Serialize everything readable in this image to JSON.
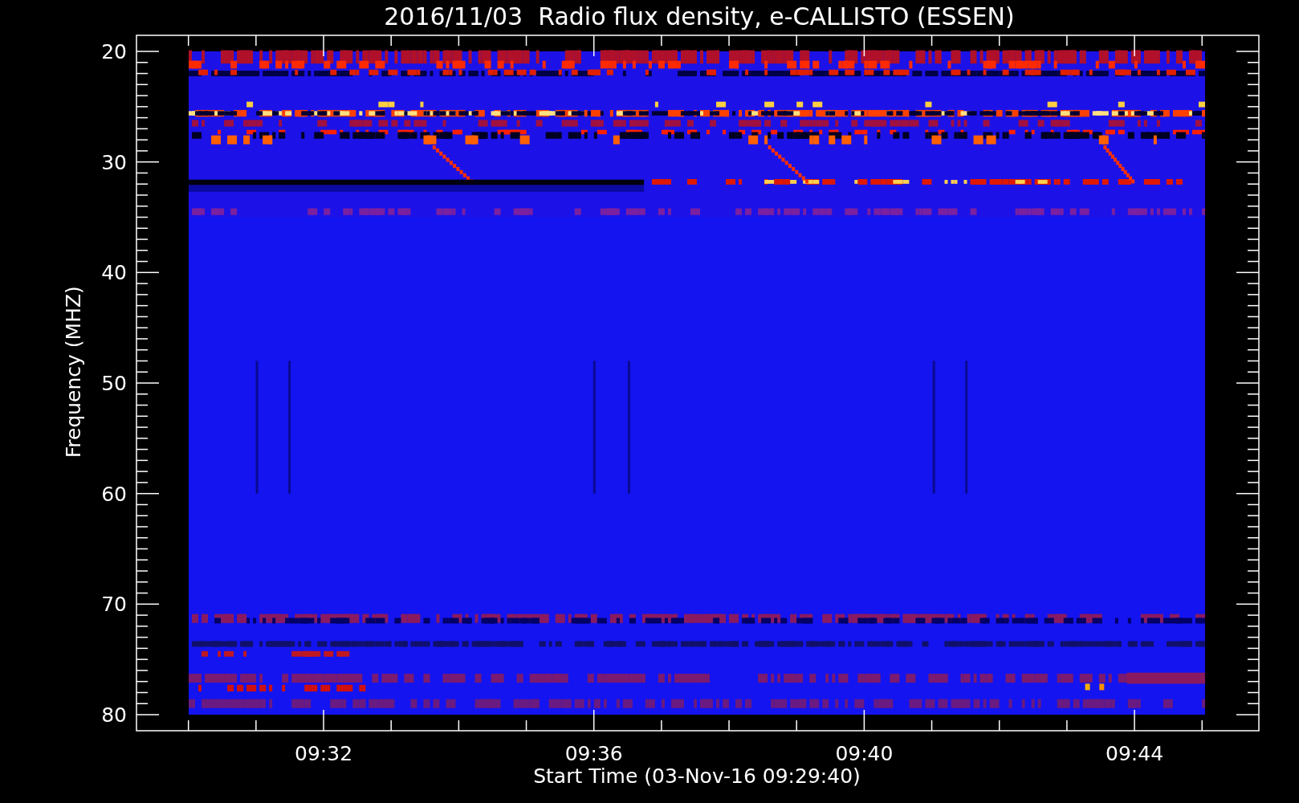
{
  "title": "2016/11/03  Radio flux density, e-CALLISTO (ESSEN)",
  "y_axis": {
    "label": "Frequency (MHZ)",
    "ticks": [
      "20",
      "30",
      "40",
      "50",
      "60",
      "70",
      "80"
    ]
  },
  "x_axis": {
    "label": "Start Time (03-Nov-16 09:29:40)",
    "ticks": [
      "09:32",
      "09:36",
      "09:40",
      "09:44"
    ]
  }
}
